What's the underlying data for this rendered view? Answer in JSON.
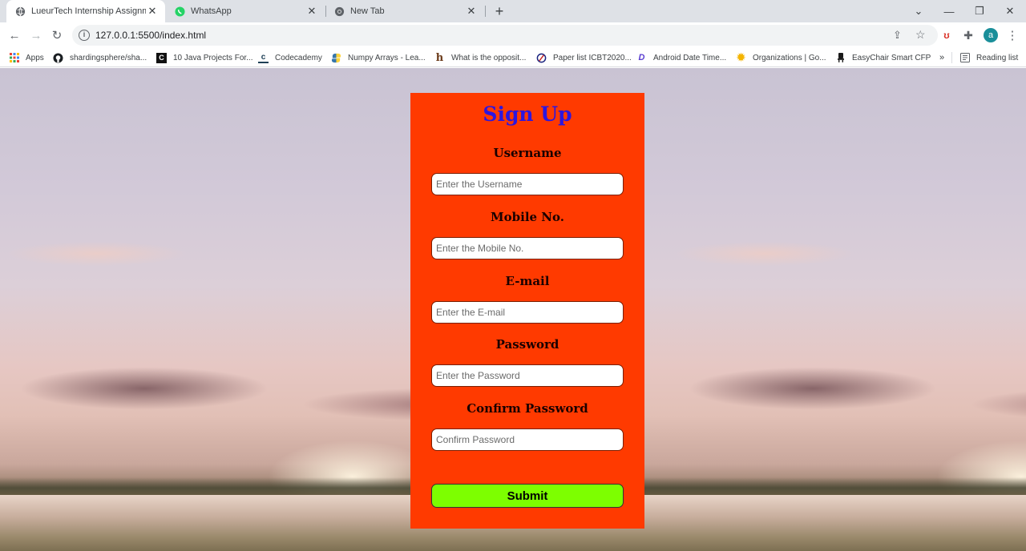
{
  "tabs": [
    {
      "title": "LueurTech Internship Assignment",
      "favicon": "globe-icon"
    },
    {
      "title": "WhatsApp",
      "favicon": "whatsapp-icon"
    },
    {
      "title": "New Tab",
      "favicon": "chrome-icon"
    }
  ],
  "address_bar": {
    "url": "127.0.0.1:5500/index.html"
  },
  "profile": {
    "initial": "a"
  },
  "bookmarks": {
    "items": [
      {
        "label": "Apps",
        "icon": "apps-grid-icon"
      },
      {
        "label": "shardingsphere/sha...",
        "icon": "github-icon"
      },
      {
        "label": "10 Java Projects For...",
        "icon": "c-icon"
      },
      {
        "label": "Codecademy",
        "icon": "codecademy-icon"
      },
      {
        "label": "Numpy Arrays - Lea...",
        "icon": "python-icon"
      },
      {
        "label": "What is the opposit...",
        "icon": "h-icon"
      },
      {
        "label": "Paper list ICBT2020...",
        "icon": "paper-icon"
      },
      {
        "label": "Android Date Time...",
        "icon": "dd-icon"
      },
      {
        "label": "Organizations | Go...",
        "icon": "sun-icon"
      },
      {
        "label": "EasyChair Smart CFP",
        "icon": "chair-icon"
      }
    ],
    "overflow": "»",
    "reading_list": "Reading list"
  },
  "form": {
    "title": "Sign Up",
    "fields": [
      {
        "label": "Username",
        "placeholder": "Enter the Username"
      },
      {
        "label": "Mobile No.",
        "placeholder": "Enter the Mobile No."
      },
      {
        "label": "E-mail",
        "placeholder": "Enter the E-mail"
      },
      {
        "label": "Password",
        "placeholder": "Enter the Password"
      },
      {
        "label": "Confirm Password",
        "placeholder": "Confirm Password"
      }
    ],
    "submit_label": "Submit"
  },
  "colors": {
    "card_bg": "#ff3a00",
    "title": "#2c16e0",
    "submit_bg": "#7dff00"
  }
}
